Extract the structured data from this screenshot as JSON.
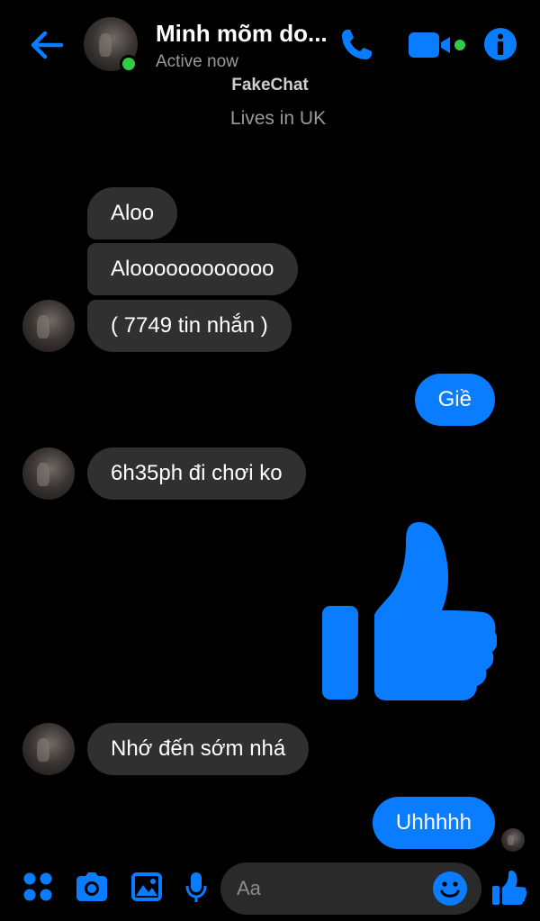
{
  "header": {
    "contact_name": "Minh mõm do...",
    "status": "Active now",
    "watermark": "FakeChat"
  },
  "profile": {
    "location": "Lives in UK"
  },
  "messages": [
    {
      "sender": "them",
      "text": "Aloo"
    },
    {
      "sender": "them",
      "text": "Aloooooooooooo"
    },
    {
      "sender": "them",
      "text": "( 7749 tin nhắn )"
    },
    {
      "sender": "me",
      "text": "Giề"
    },
    {
      "sender": "them",
      "text": "6h35ph đi chơi ko"
    },
    {
      "sender": "me",
      "type": "large-like",
      "icon": "thumbs-up-icon"
    },
    {
      "sender": "them",
      "text": "Nhớ đến sớm nhá"
    },
    {
      "sender": "me",
      "text": "Uhhhhh"
    }
  ],
  "composer": {
    "placeholder": "Aa"
  },
  "colors": {
    "accent": "#0a7cff",
    "background": "#000000",
    "incoming_bubble": "#303030",
    "online": "#31cc46"
  }
}
